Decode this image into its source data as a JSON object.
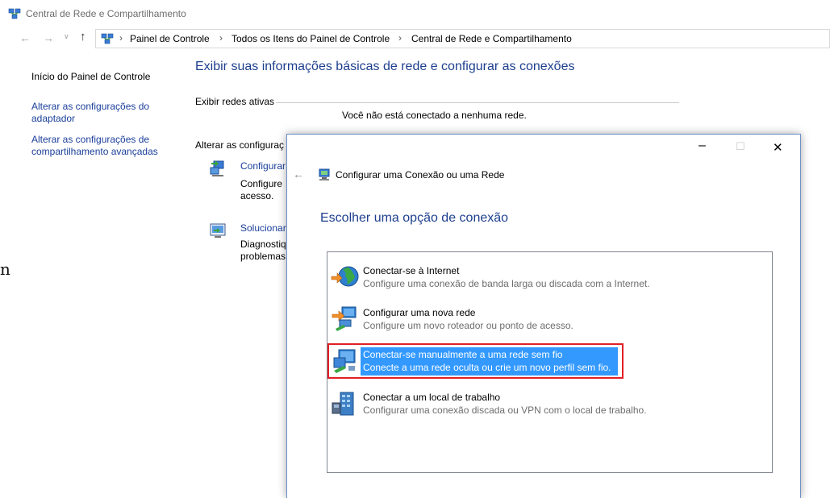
{
  "window": {
    "title": "Central de Rede e Compartilhamento"
  },
  "address_bar": {
    "breadcrumbs": [
      "Painel de Controle",
      "Todos os Itens do Painel de Controle",
      "Central de Rede e Compartilhamento"
    ],
    "separator": "›"
  },
  "sidebar": {
    "home": "Início do Painel de Controle",
    "adapter_line1": "Alterar as configurações do",
    "adapter_line2": "adaptador",
    "sharing_line1": "Alterar as configurações de",
    "sharing_line2": "compartilhamento avançadas"
  },
  "main": {
    "heading": "Exibir suas informações básicas de rede e configurar as conexões",
    "active_networks_label": "Exibir redes ativas",
    "not_connected": "Você não está conectado a nenhuma rede.",
    "change_label": "Alterar as configuraç",
    "task1": {
      "title": "Configurar",
      "desc1": "Configure",
      "desc2": "acesso."
    },
    "task2": {
      "title": "Solucionar",
      "desc1": "Diagnostiq",
      "desc2": "problemas"
    },
    "stray_glyph": "n"
  },
  "wizard": {
    "title": "Configurar uma Conexão ou uma Rede",
    "heading": "Escolher uma opção de conexão",
    "options": [
      {
        "title": "Conectar-se à Internet",
        "desc": "Configure uma conexão de banda larga ou discada com a Internet.",
        "icon": "globe-icon"
      },
      {
        "title": "Configurar uma nova rede",
        "desc": "Configure um novo roteador ou ponto de acesso.",
        "icon": "router-icon"
      },
      {
        "title": "Conectar-se manualmente a uma rede sem fio",
        "desc": "Conecte a uma rede oculta ou crie um novo perfil sem fio.",
        "icon": "wireless-icon",
        "selected": true
      },
      {
        "title": "Conectar a um local de trabalho",
        "desc": "Configurar uma conexão discada ou VPN com o local de trabalho.",
        "icon": "workplace-icon"
      }
    ]
  },
  "colors": {
    "link": "#1a3e9a",
    "heading": "#1e3f8f",
    "selection": "#3399ff",
    "highlight_frame": "#e21f26"
  }
}
